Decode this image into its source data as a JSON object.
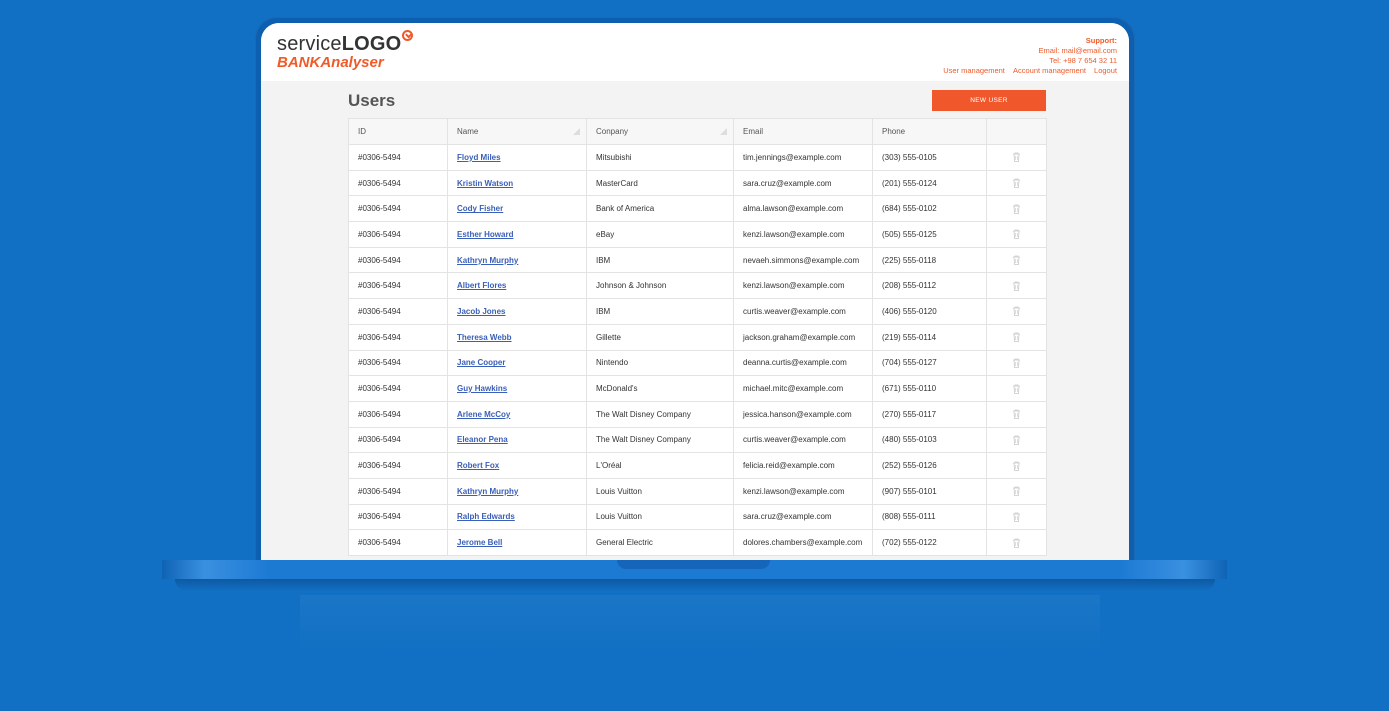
{
  "header": {
    "logo_prefix": "service",
    "logo_bold": "LOGO",
    "logo_sub": "BANKAnalyser",
    "support_title": "Support:",
    "support_email": "Email: mail@email.com",
    "support_tel": "Tel: +98 7 654 32 11",
    "nav": [
      "User management",
      "Account management",
      "Logout"
    ]
  },
  "page": {
    "title": "Users",
    "new_user_label": "NEW USER"
  },
  "table": {
    "columns": [
      "ID",
      "Name",
      "Conpany",
      "Email",
      "Phone",
      ""
    ],
    "rows": [
      [
        "#0306-5494",
        "Floyd Miles",
        "Mitsubishi",
        "tim.jennings@example.com",
        "(303) 555-0105"
      ],
      [
        "#0306-5494",
        "Kristin Watson",
        "MasterCard",
        "sara.cruz@example.com",
        "(201) 555-0124"
      ],
      [
        "#0306-5494",
        "Cody Fisher",
        "Bank of America",
        "alma.lawson@example.com",
        "(684) 555-0102"
      ],
      [
        "#0306-5494",
        "Esther Howard",
        "eBay",
        "kenzi.lawson@example.com",
        "(505) 555-0125"
      ],
      [
        "#0306-5494",
        "Kathryn Murphy",
        "IBM",
        "nevaeh.simmons@example.com",
        "(225) 555-0118"
      ],
      [
        "#0306-5494",
        "Albert Flores",
        "Johnson & Johnson",
        "kenzi.lawson@example.com",
        "(208) 555-0112"
      ],
      [
        "#0306-5494",
        "Jacob Jones",
        "IBM",
        "curtis.weaver@example.com",
        "(406) 555-0120"
      ],
      [
        "#0306-5494",
        "Theresa Webb",
        "Gillette",
        "jackson.graham@example.com",
        "(219) 555-0114"
      ],
      [
        "#0306-5494",
        "Jane Cooper",
        "Nintendo",
        "deanna.curtis@example.com",
        "(704) 555-0127"
      ],
      [
        "#0306-5494",
        "Guy Hawkins",
        "McDonald's",
        "michael.mitc@example.com",
        "(671) 555-0110"
      ],
      [
        "#0306-5494",
        "Arlene McCoy",
        "The Walt Disney Company",
        "jessica.hanson@example.com",
        "(270) 555-0117"
      ],
      [
        "#0306-5494",
        "Eleanor Pena",
        "The Walt Disney Company",
        "curtis.weaver@example.com",
        "(480) 555-0103"
      ],
      [
        "#0306-5494",
        "Robert Fox",
        "L'Oréal",
        "felicia.reid@example.com",
        "(252) 555-0126"
      ],
      [
        "#0306-5494",
        "Kathryn Murphy",
        "Louis Vuitton",
        "kenzi.lawson@example.com",
        "(907) 555-0101"
      ],
      [
        "#0306-5494",
        "Ralph Edwards",
        "Louis Vuitton",
        "sara.cruz@example.com",
        "(808) 555-0111"
      ],
      [
        "#0306-5494",
        "Jerome Bell",
        "General Electric",
        "dolores.chambers@example.com",
        "(702) 555-0122"
      ]
    ]
  },
  "colors": {
    "background": "#1170c4",
    "accent": "#f05a28",
    "link": "#3a5fb8"
  }
}
